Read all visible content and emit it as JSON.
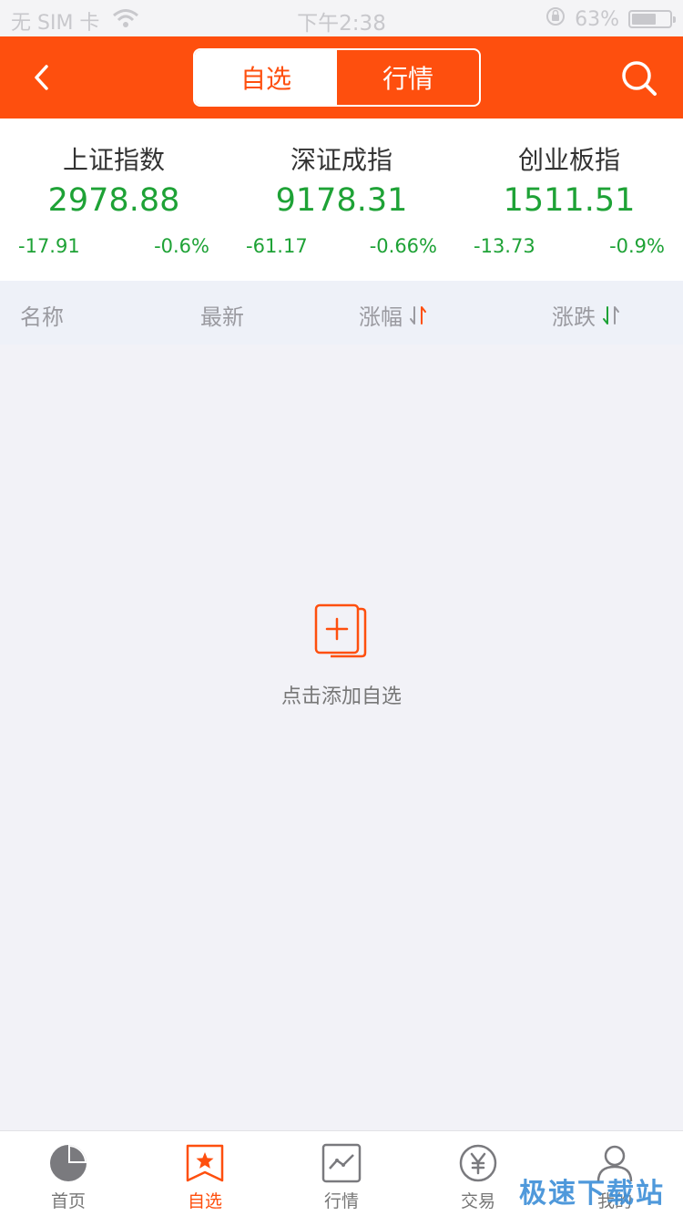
{
  "status_bar": {
    "carrier": "无 SIM 卡",
    "time": "下午2:38",
    "battery": "63%"
  },
  "nav": {
    "tabs": [
      {
        "label": "自选",
        "active": true
      },
      {
        "label": "行情",
        "active": false
      }
    ],
    "accent_color": "#fe4f0e"
  },
  "indices": [
    {
      "name": "上证指数",
      "value": "2978.88",
      "change": "-17.91",
      "change_pct": "-0.6%"
    },
    {
      "name": "深证成指",
      "value": "9178.31",
      "change": "-61.17",
      "change_pct": "-0.66%"
    },
    {
      "name": "创业板指",
      "value": "1511.51",
      "change": "-13.73",
      "change_pct": "-0.9%"
    }
  ],
  "columns": {
    "name": "名称",
    "latest": "最新",
    "change_pct": "涨幅",
    "change_amt": "涨跌"
  },
  "empty_state": {
    "text": "点击添加自选",
    "icon": "add-stock-icon"
  },
  "tab_bar": [
    {
      "label": "首页",
      "icon": "home-pie-icon",
      "active": false
    },
    {
      "label": "自选",
      "icon": "watchlist-star-icon",
      "active": true
    },
    {
      "label": "行情",
      "icon": "market-chart-icon",
      "active": false
    },
    {
      "label": "交易",
      "icon": "trade-yen-icon",
      "active": false
    },
    {
      "label": "我的",
      "icon": "profile-icon",
      "active": false
    }
  ],
  "watermark": "极速下载站",
  "colors": {
    "down_green": "#1ea236",
    "up_red": "#fe4f0e"
  }
}
